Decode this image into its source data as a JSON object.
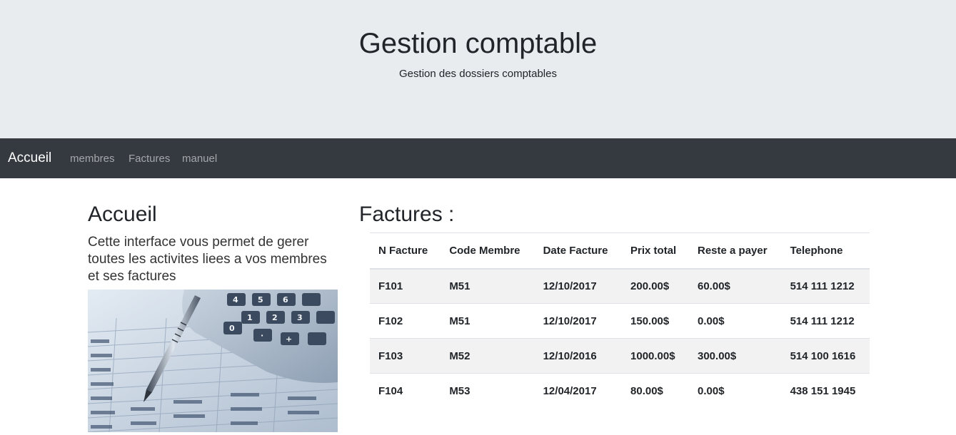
{
  "header": {
    "title": "Gestion comptable",
    "subtitle": "Gestion des dossiers comptables"
  },
  "navbar": {
    "brand": "Accueil",
    "links": [
      "membres",
      "Factures",
      "manuel"
    ]
  },
  "intro": {
    "heading": "Accueil",
    "text": "Cette interface vous permet de gerer toutes les activites liees a vos membres et ses factures"
  },
  "invoices": {
    "heading": "Factures :",
    "columns": [
      "N Facture",
      "Code Membre",
      "Date Facture",
      "Prix total",
      "Reste a payer",
      "Telephone"
    ],
    "rows": [
      [
        "F101",
        "M51",
        "12/10/2017",
        "200.00$",
        "60.00$",
        "514 111 1212"
      ],
      [
        "F102",
        "M51",
        "12/10/2017",
        "150.00$",
        "0.00$",
        "514 111 1212"
      ],
      [
        "F103",
        "M52",
        "12/10/2016",
        "1000.00$",
        "300.00$",
        "514 100 1616"
      ],
      [
        "F104",
        "M53",
        "12/04/2017",
        "80.00$",
        "0.00$",
        "438 151 1945"
      ]
    ]
  },
  "colors": {
    "jumbotron_bg": "#e9ecef",
    "navbar_bg": "#343a40",
    "stripe_bg": "#f2f2f2"
  }
}
